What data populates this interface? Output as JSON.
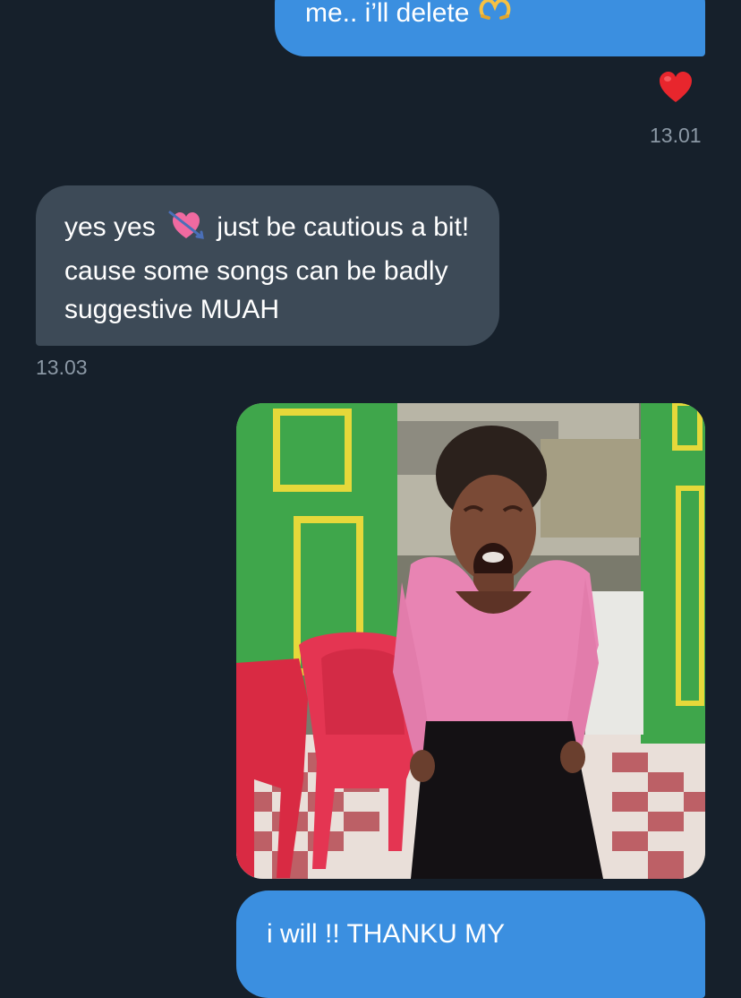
{
  "conversation": {
    "messages": [
      {
        "direction": "sent",
        "text": "me.. i’ll delete",
        "emoji": "heart-hands-icon"
      },
      {
        "direction": "received",
        "text_before_emoji": "yes yes",
        "emoji": "heart-with-arrow-icon",
        "text_after_emoji": "just be cautious a bit! cause some songs can be badly suggestive MUAH",
        "time": "13.03"
      },
      {
        "direction": "sent",
        "type": "image",
        "image_alt": "crying-girl-meme-image"
      },
      {
        "direction": "sent",
        "text": "i will !! THANKU MY"
      }
    ],
    "reaction": {
      "emoji": "red-heart-icon",
      "time": "13.01"
    }
  },
  "colors": {
    "background": "#16202b",
    "sent_bubble": "#3b8fe0",
    "received_bubble": "#3d4a57",
    "timestamp": "#8b98a5"
  }
}
